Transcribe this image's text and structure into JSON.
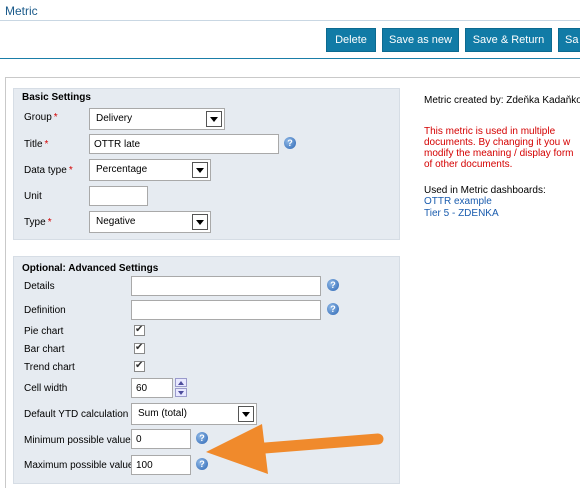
{
  "header": {
    "title": "Metric"
  },
  "toolbar": {
    "delete_label": "Delete",
    "save_as_new_label": "Save as new",
    "save_return_label": "Save & Return",
    "save_label": "Sa"
  },
  "basic": {
    "title": "Basic Settings",
    "group_label": "Group",
    "group_value": "Delivery",
    "title_label": "Title",
    "title_value": "OTTR late",
    "datatype_label": "Data type",
    "datatype_value": "Percentage",
    "unit_label": "Unit",
    "unit_value": "",
    "type_label": "Type",
    "type_value": "Negative",
    "required_mark": "*"
  },
  "advanced": {
    "title": "Optional: Advanced Settings",
    "details_label": "Details",
    "details_value": "",
    "definition_label": "Definition",
    "definition_value": "",
    "pie_label": "Pie chart",
    "bar_label": "Bar chart",
    "trend_label": "Trend chart",
    "cellwidth_label": "Cell width",
    "cellwidth_value": "60",
    "ytd_label": "Default YTD calculation",
    "ytd_value": "Sum (total)",
    "min_label": "Minimum possible value",
    "min_value": "0",
    "max_label": "Maximum possible value",
    "max_value": "100"
  },
  "info": {
    "created_by": "Metric created by: Zdeňka Kadaňková",
    "warning_lines": [
      "This metric is used in multiple",
      "documents. By changing it you w",
      "modify the meaning / display form",
      "of other documents."
    ],
    "dashboards_heading": "Used in Metric dashboards:",
    "dashboards": [
      "OTTR example",
      "Tier 5 - ZDENKA"
    ]
  },
  "help_glyph": "?",
  "colors": {
    "button_bg": "#117ba6",
    "arrow": "#f08a2c",
    "warning": "#d40000",
    "link": "#1a5cae"
  }
}
